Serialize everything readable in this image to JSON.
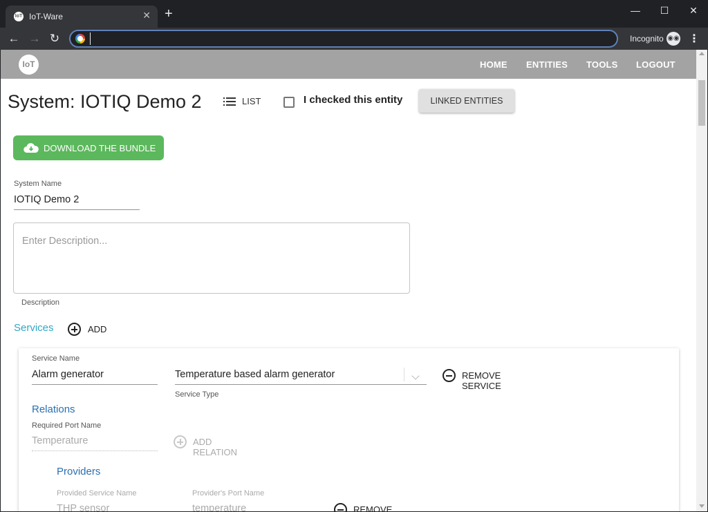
{
  "browser": {
    "tab_title": "IoT-Ware",
    "tab_favicon_text": "IoT",
    "tab_close": "✕",
    "new_tab": "+",
    "window_controls": {
      "minimize": "—",
      "maximize": "☐",
      "close": "✕"
    },
    "nav": {
      "back": "←",
      "forward": "→",
      "reload": "↻"
    },
    "address": "",
    "incognito_label": "Incognito",
    "menu": "⋮"
  },
  "app": {
    "logo_text": "IoT",
    "nav": [
      "HOME",
      "ENTITIES",
      "TOOLS",
      "LOGOUT"
    ]
  },
  "page": {
    "title": "System: IOTIQ Demo 2",
    "list_label": "LIST",
    "checked_label": "I checked this entity",
    "linked_entities_label": "LINKED ENTITIES",
    "download_label": "DOWNLOAD THE BUNDLE",
    "system_name_label": "System Name",
    "system_name_value": "IOTIQ Demo 2",
    "description_placeholder": "Enter Description...",
    "description_label": "Description",
    "services_title": "Services",
    "add_label": "ADD"
  },
  "service": {
    "name_label": "Service Name",
    "name_value": "Alarm generator",
    "type_value": "Temperature based alarm generator",
    "type_label": "Service Type",
    "remove_service_label": "REMOVE SERVICE",
    "relations_title": "Relations",
    "required_port_label": "Required Port Name",
    "required_port_value": "Temperature",
    "add_relation_label": "ADD RELATION",
    "providers_title": "Providers",
    "provided_service_label": "Provided Service Name",
    "provided_service_value": "THP sensor",
    "provider_port_label": "Provider's Port Name",
    "provider_port_value": "temperature",
    "remove_relation_label": "REMOVE RELATION"
  }
}
